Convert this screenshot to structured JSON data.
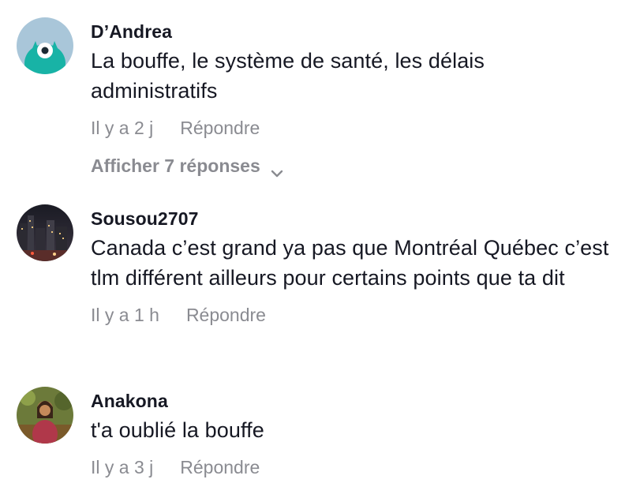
{
  "comments": [
    {
      "username": "D’Andrea",
      "text": "La bouffe, le système de santé, les délais administratifs",
      "time": "Il y a 2 j",
      "reply_label": "Répondre",
      "view_replies_label": "Afficher 7 réponses",
      "avatar_icon": "monster-avatar-icon"
    },
    {
      "username": "Sousou2707",
      "text": "Canada c’est grand ya pas que Montréal Québec c’est tlm différent ailleurs pour certains points que ta dit",
      "time": "Il y a 1 h",
      "reply_label": "Répondre",
      "avatar_icon": "city-night-avatar-icon"
    },
    {
      "username": "Anakona",
      "text": "t'a oublié la bouffe",
      "time": "Il y a 3 j",
      "reply_label": "Répondre",
      "avatar_icon": "person-avatar-icon"
    }
  ],
  "colors": {
    "primary_text": "#161823",
    "secondary_text": "#8a8b91",
    "background": "#ffffff"
  }
}
